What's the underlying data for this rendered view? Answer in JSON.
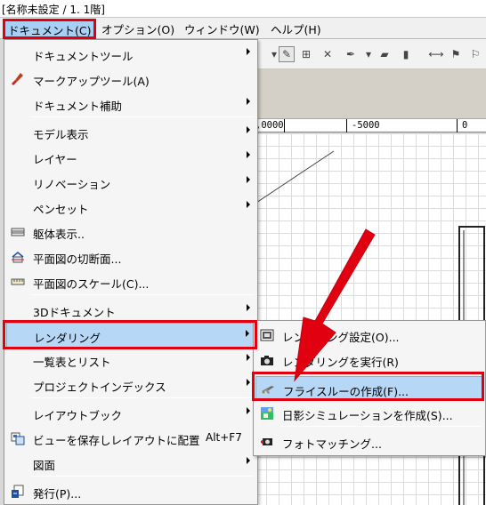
{
  "window": {
    "title": "[名称未設定 / 1. 1階]"
  },
  "menubar": [
    {
      "label": "ドキュメント(C)",
      "active": true
    },
    {
      "label": "オプション(O)"
    },
    {
      "label": "ウィンドウ(W)"
    },
    {
      "label": "ヘルプ(H)"
    }
  ],
  "ruler": {
    "labels": [
      ",0000",
      "-5000",
      "0"
    ]
  },
  "document_menu": {
    "items": [
      {
        "label": "ドキュメントツール",
        "submenu": true
      },
      {
        "label": "マークアップツール(A)",
        "icon": "markup-brush-icon"
      },
      {
        "label": "ドキュメント補助",
        "submenu": true
      },
      {
        "label": "モデル表示",
        "submenu": true
      },
      {
        "label": "レイヤー",
        "submenu": true
      },
      {
        "label": "リノベーション",
        "submenu": true
      },
      {
        "label": "ペンセット",
        "submenu": true
      },
      {
        "label": "躯体表示..",
        "icon": "structure-display-icon"
      },
      {
        "label": "平面図の切断面...",
        "icon": "floor-plan-cut-icon"
      },
      {
        "label": "平面図のスケール(C)...",
        "icon": "scale-icon"
      },
      {
        "label": "3Dドキュメント",
        "submenu": true
      },
      {
        "label": "レンダリング",
        "submenu": true,
        "selected": true
      },
      {
        "label": "一覧表とリスト",
        "submenu": true
      },
      {
        "label": "プロジェクトインデックス",
        "submenu": true
      },
      {
        "label": "レイアウトブック",
        "submenu": true
      },
      {
        "label": "ビューを保存しレイアウトに配置",
        "shortcut": "Alt+F7",
        "icon": "save-view-icon"
      },
      {
        "label": "図面",
        "submenu": true
      },
      {
        "label": "発行(P)...",
        "icon": "publish-icon"
      }
    ]
  },
  "rendering_submenu": {
    "items": [
      {
        "label": "レンダリング設定(O)...",
        "icon": "render-settings-icon"
      },
      {
        "label": "レンダリングを実行(R)",
        "icon": "camera-icon"
      },
      {
        "label": "フライスルーの作成(F)...",
        "icon": "flythrough-icon",
        "selected": true
      },
      {
        "label": "日影シミュレーションを作成(S)...",
        "icon": "sun-study-icon"
      },
      {
        "label": "フォトマッチング...",
        "icon": "photo-matching-icon"
      }
    ]
  },
  "colors": {
    "highlight_box": "#e00010",
    "arrow": "#e00010",
    "selection": "#b6d8f6"
  }
}
